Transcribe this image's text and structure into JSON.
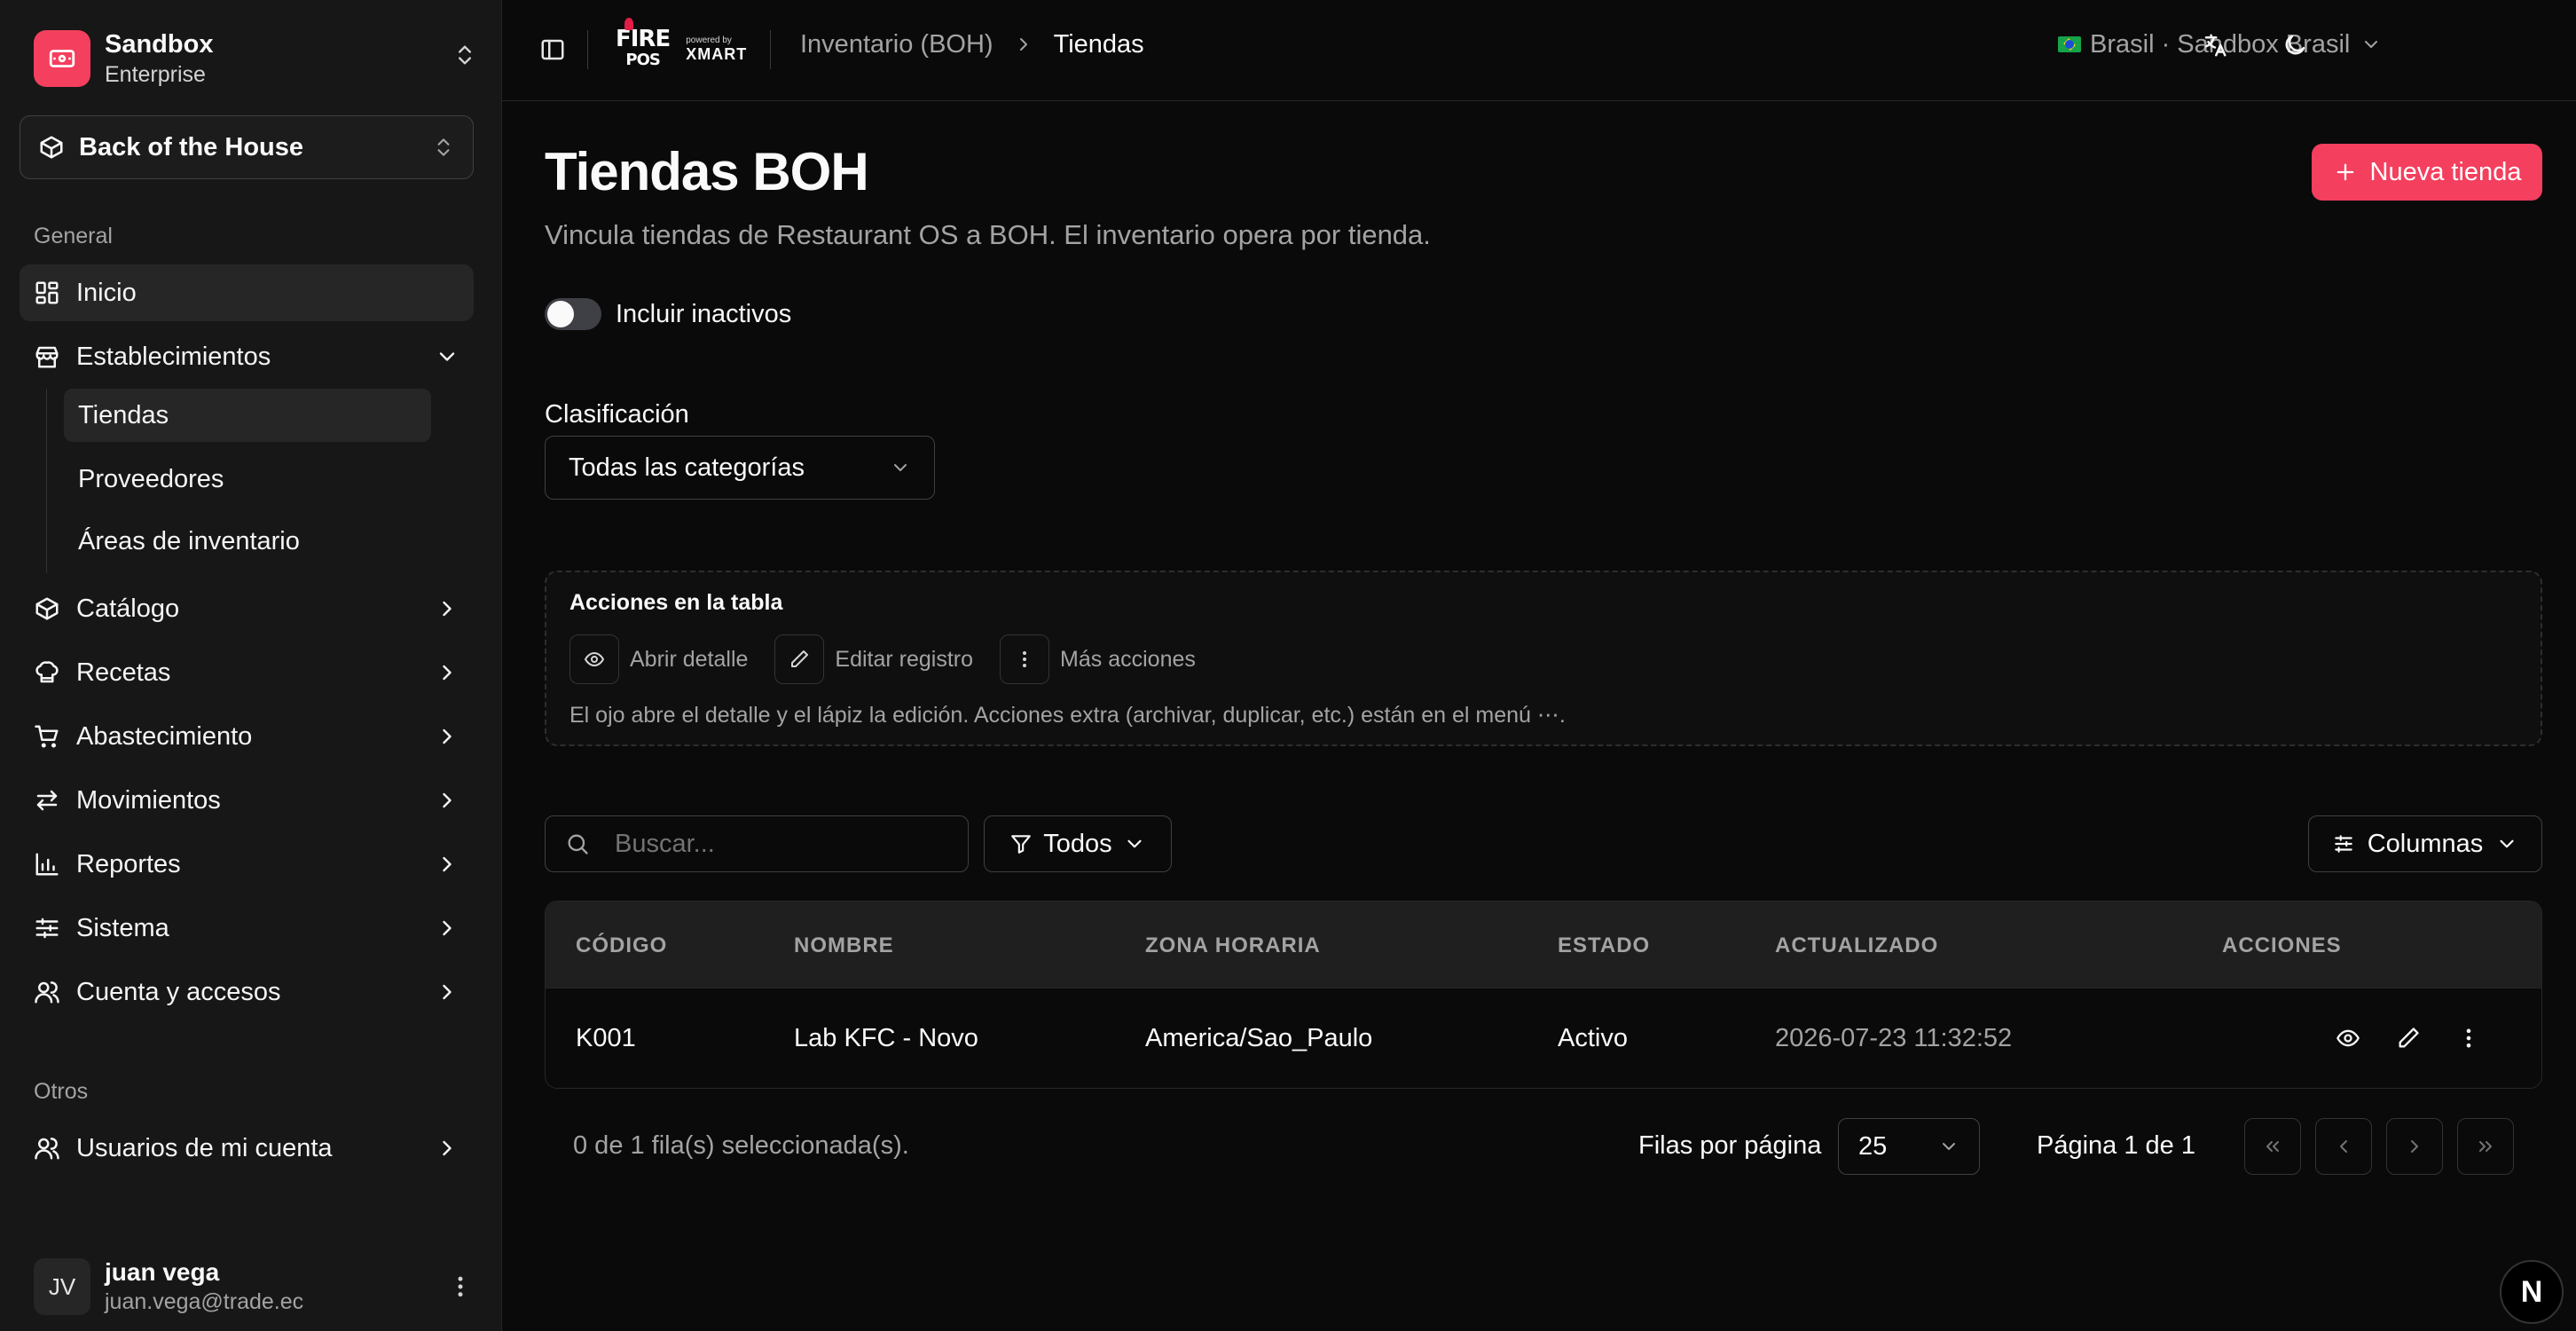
{
  "sidebar": {
    "org": {
      "name": "Sandbox",
      "plan": "Enterprise"
    },
    "module": {
      "label": "Back of the House"
    },
    "sections": {
      "general": "General",
      "others": "Otros"
    },
    "items": [
      {
        "label": "Inicio",
        "icon": "dashboard-icon",
        "active": true
      },
      {
        "label": "Establecimientos",
        "icon": "store-icon",
        "expanded": true
      },
      {
        "label": "Catálogo",
        "icon": "package-icon"
      },
      {
        "label": "Recetas",
        "icon": "chef-hat-icon"
      },
      {
        "label": "Abastecimiento",
        "icon": "cart-icon"
      },
      {
        "label": "Movimientos",
        "icon": "arrows-icon"
      },
      {
        "label": "Reportes",
        "icon": "bar-chart-icon"
      },
      {
        "label": "Sistema",
        "icon": "sliders-icon"
      },
      {
        "label": "Cuenta y accesos",
        "icon": "users-icon"
      }
    ],
    "sub_items": [
      {
        "label": "Tiendas",
        "active": true
      },
      {
        "label": "Proveedores"
      },
      {
        "label": "Áreas de inventario"
      }
    ],
    "other_items": [
      {
        "label": "Usuarios de mi cuenta",
        "icon": "users-icon"
      }
    ],
    "user": {
      "initials": "JV",
      "name": "juan vega",
      "email": "juan.vega@trade.ec"
    }
  },
  "header": {
    "brand": {
      "fire": "FIRE",
      "pos": "POS",
      "powered": "powered by",
      "xmart": "XMART"
    },
    "breadcrumb": {
      "parent": "Inventario (BOH)",
      "current": "Tiendas"
    },
    "country": "Brasil · Sandbox Brasil"
  },
  "page": {
    "title": "Tiendas BOH",
    "subtitle": "Vincula tiendas de Restaurant OS a BOH. El inventario opera por tienda.",
    "new_button": "Nueva tienda",
    "include_inactive": {
      "label": "Incluir inactivos",
      "checked": false
    },
    "classification": {
      "label": "Clasificación",
      "value": "Todas las categorías"
    }
  },
  "help": {
    "title": "Acciones en la tabla",
    "actions": [
      {
        "label": "Abrir detalle",
        "icon": "eye-icon"
      },
      {
        "label": "Editar registro",
        "icon": "pencil-icon"
      },
      {
        "label": "Más acciones",
        "icon": "more-vertical-icon"
      }
    ],
    "text": "El ojo abre el detalle y el lápiz la edición. Acciones extra (archivar, duplicar, etc.) están en el menú ⋯."
  },
  "toolbar": {
    "search_placeholder": "Buscar...",
    "filter_label": "Todos",
    "columns_label": "Columnas"
  },
  "table": {
    "headers": [
      "CÓDIGO",
      "NOMBRE",
      "ZONA HORARIA",
      "ESTADO",
      "ACTUALIZADO",
      "ACCIONES"
    ],
    "rows": [
      {
        "code": "K001",
        "name": "Lab KFC - Novo",
        "timezone": "America/Sao_Paulo",
        "status": "Activo",
        "updated": "2026-07-23 11:32:52"
      }
    ]
  },
  "pagination": {
    "selection": "0 de 1 fila(s) seleccionada(s).",
    "rows_per_page_label": "Filas por página",
    "rows_per_page": "25",
    "page_label": "Página 1 de 1"
  },
  "badge": "N",
  "colors": {
    "accent": "#f43f5e",
    "background": "#0a0a0a",
    "sidebar": "#171717"
  }
}
